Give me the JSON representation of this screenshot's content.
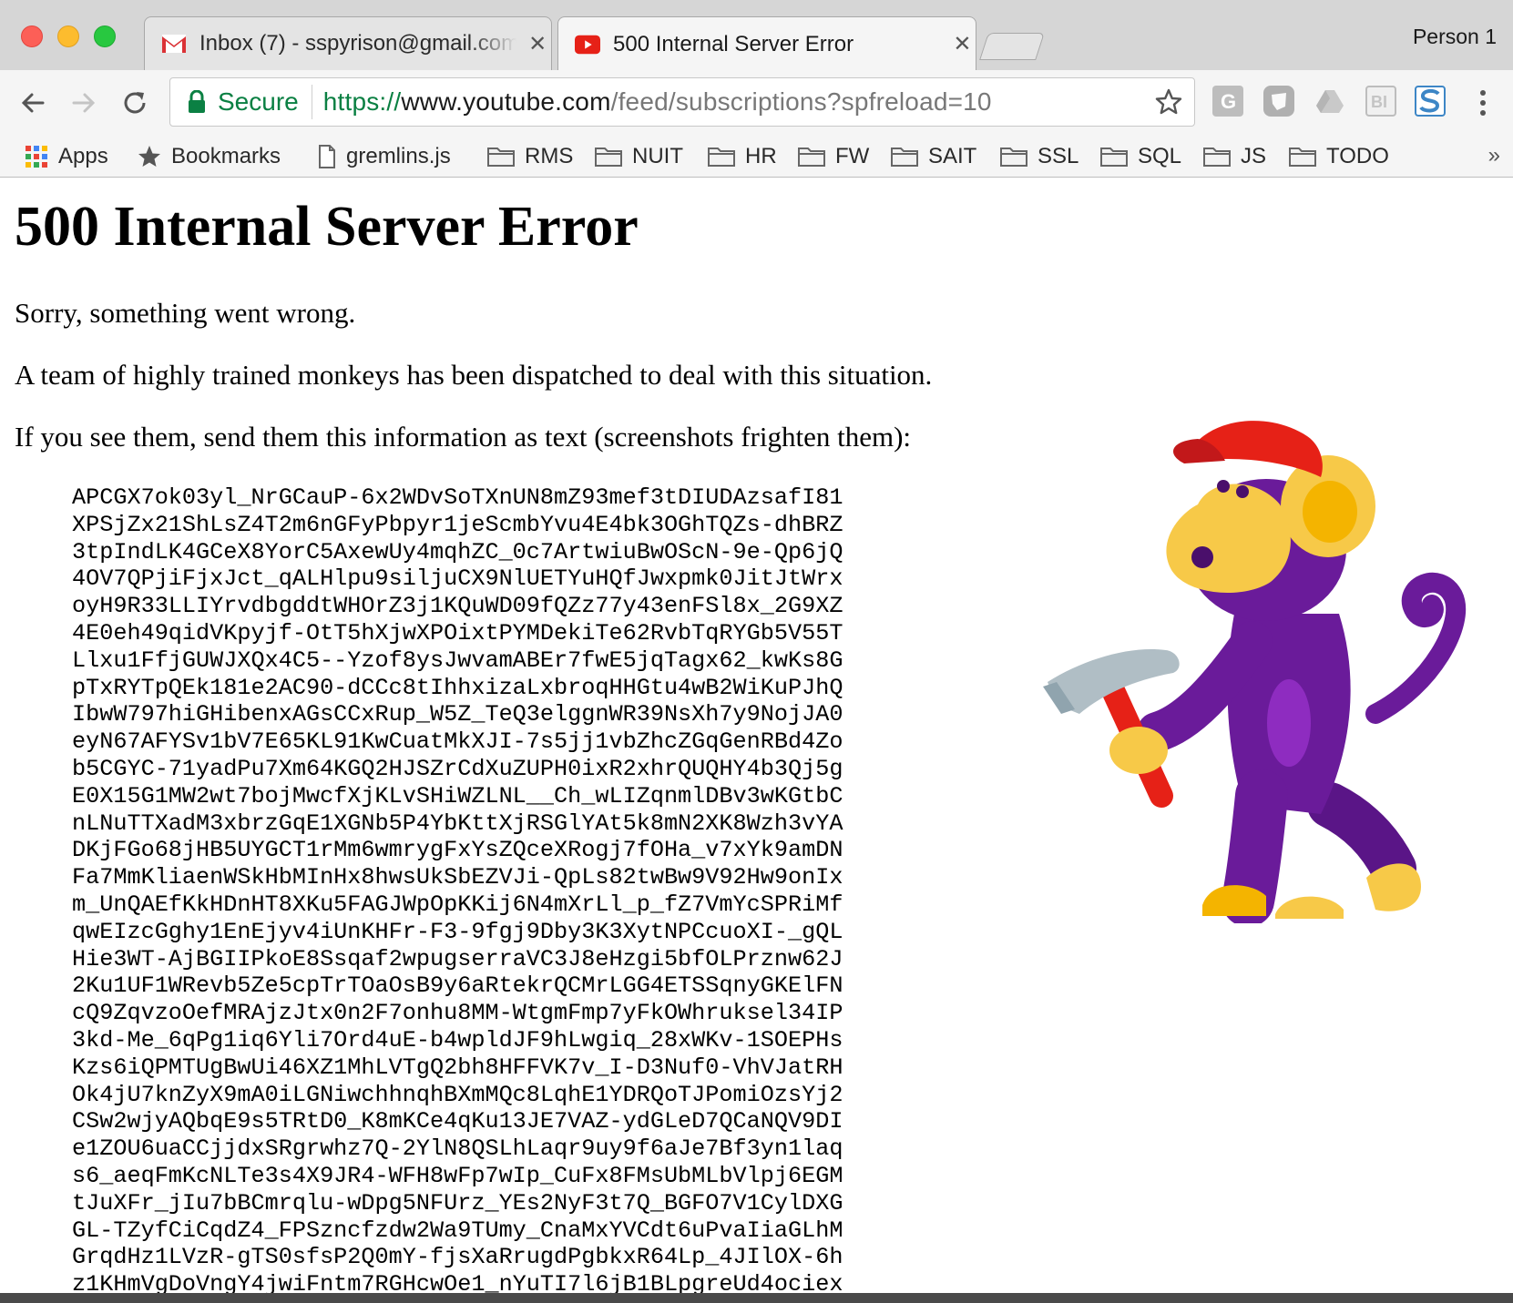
{
  "browser": {
    "profile_name": "Person 1",
    "tabs": [
      {
        "title": "Inbox (7) - sspyrison@gmail.com",
        "favicon": "gmail-icon",
        "active": false
      },
      {
        "title": "500 Internal Server Error",
        "favicon": "youtube-icon",
        "active": true
      }
    ],
    "address_bar": {
      "secure_label": "Secure",
      "url_scheme": "https://",
      "url_host": "www.youtube.com",
      "url_path": "/feed/subscriptions?spfreload=10"
    },
    "bookmarks": [
      {
        "label": "Apps",
        "icon": "apps-grid-icon"
      },
      {
        "label": "Bookmarks",
        "icon": "star-icon"
      },
      {
        "label": "gremlins.js",
        "icon": "page-icon"
      },
      {
        "label": "RMS",
        "icon": "folder-icon"
      },
      {
        "label": "NUIT",
        "icon": "folder-icon"
      },
      {
        "label": "HR",
        "icon": "folder-icon"
      },
      {
        "label": "FW",
        "icon": "folder-icon"
      },
      {
        "label": "SAIT",
        "icon": "folder-icon"
      },
      {
        "label": "SSL",
        "icon": "folder-icon"
      },
      {
        "label": "SQL",
        "icon": "folder-icon"
      },
      {
        "label": "JS",
        "icon": "folder-icon"
      },
      {
        "label": "TODO",
        "icon": "folder-icon"
      }
    ],
    "bookmarks_overflow": "»"
  },
  "page": {
    "heading": "500 Internal Server Error",
    "para1": "Sorry, something went wrong.",
    "para2": "A team of highly trained monkeys has been dispatched to deal with this situation.",
    "para3": "If you see them, send them this information as text (screenshots frighten them):",
    "error_code_lines": [
      "APCGX7ok03yl_NrGCauP-6x2WDvSoTXnUN8mZ93mef3tDIUDAzsafI81",
      "XPSjZx21ShLsZ4T2m6nGFyPbpyr1jeScmbYvu4E4bk3OGhTQZs-dhBRZ",
      "3tpIndLK4GCeX8YorC5AxewUy4mqhZC_0c7ArtwiuBwOScN-9e-Qp6jQ",
      "4OV7QPjiFjxJct_qALHlpu9siljuCX9NlUETYuHQfJwxpmk0JitJtWrx",
      "oyH9R33LLIYrvdbgddtWHOrZ3j1KQuWD09fQZz77y43enFSl8x_2G9XZ",
      "4E0eh49qidVKpyjf-OtT5hXjwXPOixtPYMDekiTe62RvbTqRYGb5V55T",
      "Llxu1FfjGUWJXQx4C5--Yzof8ysJwvamABEr7fwE5jqTagx62_kwKs8G",
      "pTxRYTpQEk181e2AC90-dCCc8tIhhxizaLxbroqHHGtu4wB2WiKuPJhQ",
      "IbwW797hiGHibenxAGsCCxRup_W5Z_TeQ3elggnWR39NsXh7y9NojJA0",
      "eyN67AFYSv1bV7E65KL91KwCuatMkXJI-7s5jj1vbZhcZGqGenRBd4Zo",
      "b5CGYC-71yadPu7Xm64KGQ2HJSZrCdXuZUPH0ixR2xhrQUQHY4b3Qj5g",
      "E0X15G1MW2wt7bojMwcfXjKLvSHiWZLNL__Ch_wLIZqnmlDBv3wKGtbC",
      "nLNuTTXadM3xbrzGqE1XGNb5P4YbKttXjRSGlYAt5k8mN2XK8Wzh3vYA",
      "DKjFGo68jHB5UYGCT1rMm6wmrygFxYsZQceXRogj7fOHa_v7xYk9amDN",
      "Fa7MmKliaenWSkHbMInHx8hwsUkSbEZVJi-QpLs82twBw9V92Hw9onIx",
      "m_UnQAEfKkHDnHT8XKu5FAGJWpOpKKij6N4mXrLl_p_fZ7VmYcSPRiMf",
      "qwEIzcGghy1EnEjyv4iUnKHFr-F3-9fgj9Dby3K3XytNPCcuoXI-_gQL",
      "Hie3WT-AjBGIIPkoE8Ssqaf2wpugserraVC3J8eHzgi5bfOLPrznw62J",
      "2Ku1UF1WRevb5Ze5cpTrTOaOsB9y6aRtekrQCMrLGG4ETSSqnyGKElFN",
      "cQ9ZqvzoOefMRAjzJtx0n2F7onhu8MM-WtgmFmp7yFkOWhruksel34IP",
      "3kd-Me_6qPg1iq6Yli7Ord4uE-b4wpldJF9hLwgiq_28xWKv-1SOEPHs",
      "Kzs6iQPMTUgBwUi46XZ1MhLVTgQ2bh8HFFVK7v_I-D3Nuf0-VhVJatRH",
      "Ok4jU7knZyX9mA0iLGNiwchhnqhBXmMQc8LqhE1YDRQoTJPomiOzsYj2",
      "CSw2wjyAQbqE9s5TRtD0_K8mKCe4qKu13JE7VAZ-ydGLeD7QCaNQV9DI",
      "e1ZOU6uaCCjjdxSRgrwhz7Q-2YlN8QSLhLaqr9uy9f6aJe7Bf3yn1laq",
      "s6_aeqFmKcNLTe3s4X9JR4-WFH8wFp7wIp_CuFx8FMsUbMLbVlpj6EGM",
      "tJuXFr_jIu7bBCmrqlu-wDpg5NFUrz_YEs2NyF3t7Q_BGFO7V1CylDXG",
      "GL-TZyfCiCqdZ4_FPSzncfzdw2Wa9TUmy_CnaMxYVCdt6uPvaIiaGLhM",
      "GrqdHz1LVzR-gTS0sfsP2Q0mY-fjsXaRrugdPgbkxR64Lp_4JIlOX-6h",
      "z1KHmVgDoVngY4jwiFntm7RGHcwOe1_nYuTI7l6jB1BLpgreUd4ociex"
    ],
    "illustration": "monkey-with-hammer-illustration"
  },
  "colors": {
    "secure_green": "#0b8043",
    "monkey_purple": "#6a1b9a",
    "monkey_yellow": "#f7c948",
    "cap_red": "#e62117"
  }
}
